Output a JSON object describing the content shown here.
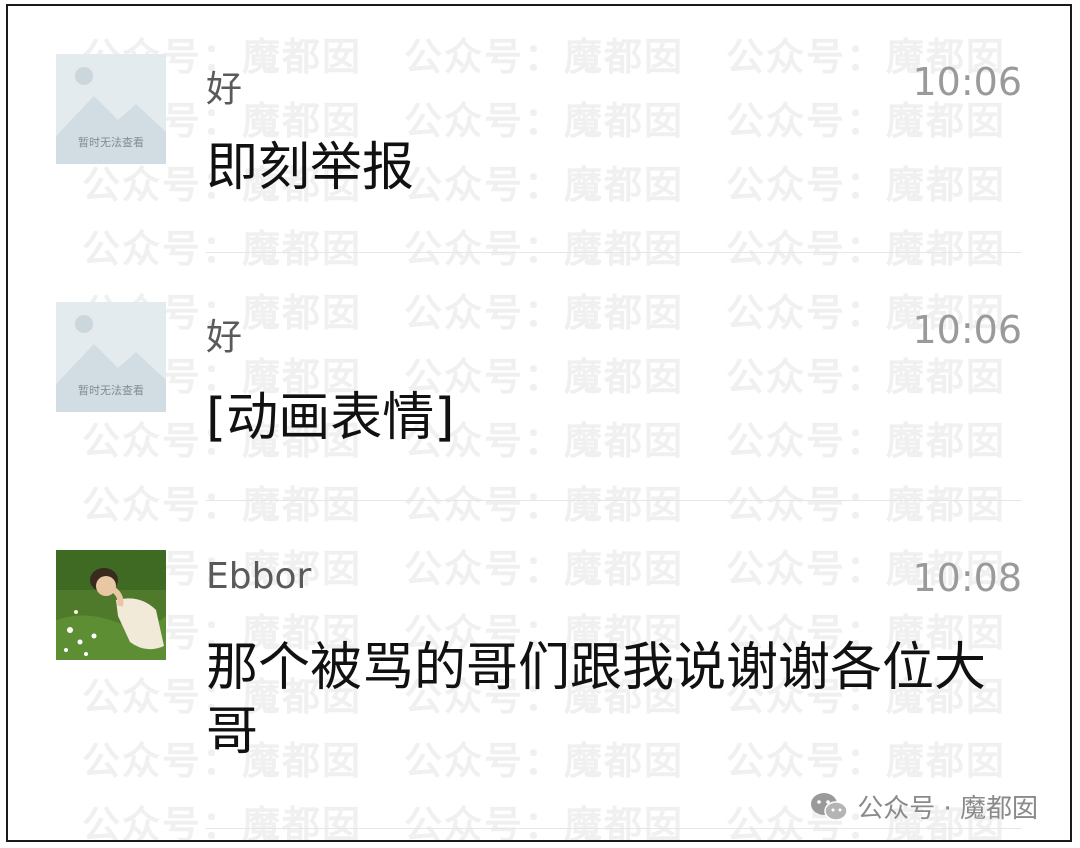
{
  "watermark": {
    "text": "公众号：魔都囡"
  },
  "messages": [
    {
      "sender": "好",
      "time": "10:06",
      "content": "即刻举报",
      "avatar": {
        "kind": "placeholder",
        "caption": "暂时无法查看"
      }
    },
    {
      "sender": "好",
      "time": "10:06",
      "content": "[动画表情]",
      "avatar": {
        "kind": "placeholder",
        "caption": "暂时无法查看"
      }
    },
    {
      "sender": "Ebbor",
      "time": "10:08",
      "content": "那个被骂的哥们跟我说谢谢各位大哥",
      "avatar": {
        "kind": "illustration"
      }
    }
  ],
  "footer": {
    "icon": "wechat-icon",
    "text": "公众号 · 魔都囡"
  },
  "colors": {
    "sender": "#5a5a5a",
    "time": "#9a9a9a",
    "content": "#111111",
    "divider": "#e6e6e6",
    "watermark": "#f0f0f0"
  }
}
